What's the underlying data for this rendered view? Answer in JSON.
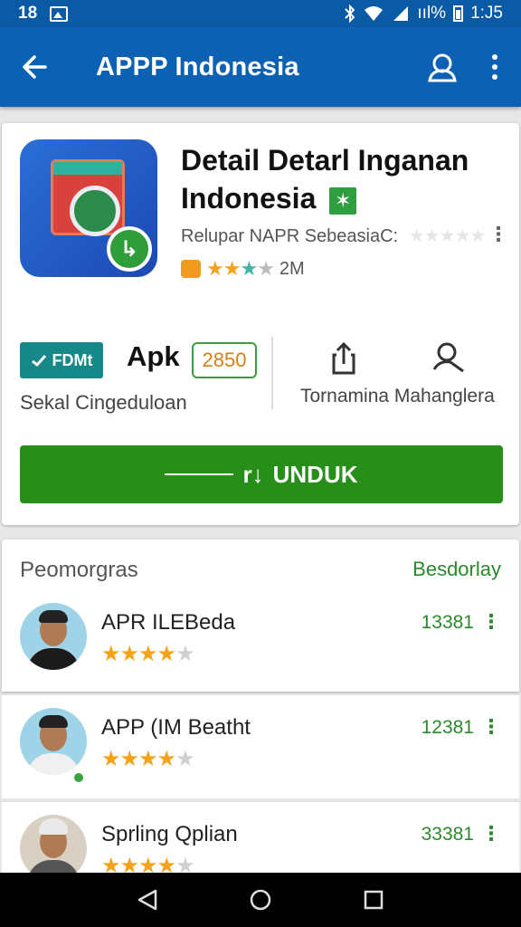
{
  "status_bar": {
    "left_time": "18",
    "right_time": "1:J5",
    "signal_pct": "ııl%"
  },
  "app_bar": {
    "title": "APPP Indonesia"
  },
  "app": {
    "title_line1": "Detail Detarl Inganan",
    "title_line2": "Indonesia",
    "verified_mark": "✶",
    "publisher": "Relupar NAPR SebeasiaC:",
    "publisher_stars": "★★★★★",
    "rating_stars_gold": "★★",
    "rating_stars_green": "★",
    "rating_stars_grey": "★",
    "rating_count": "2M",
    "more_glyph": "⋮"
  },
  "info": {
    "badge_label": "FDMt",
    "type_label": "Apk",
    "count_badge": "2850",
    "size_label": "Sekal Cingeduloan",
    "share_label": "Tornamina Mahanglera"
  },
  "download": {
    "label": "UNDUK",
    "glyph": "r↓"
  },
  "comments": {
    "title": "Peomorgras",
    "link": "Besdorlay",
    "items": [
      {
        "name": "APR ILEBeda",
        "stars_on": "★★★★",
        "stars_off": "★",
        "count": "13381",
        "more": "⋮"
      },
      {
        "name": "APP (IM Beatht",
        "stars_on": "★★★★",
        "stars_off": "★",
        "count": "12381",
        "more": "⋮"
      },
      {
        "name": "Sprling Qplian",
        "stars_on": "★★★★",
        "stars_off": "★",
        "count": "33381",
        "more": "⋮"
      }
    ]
  },
  "colors": {
    "app_bar": "#0d61b3",
    "download": "#288e1a",
    "accent_green": "#2a8a2a",
    "star": "#f4a21a"
  },
  "icons": [
    "back-arrow-icon",
    "account-icon",
    "overflow-menu-icon",
    "share-icon",
    "person-icon",
    "back-nav-icon",
    "home-nav-icon",
    "recents-nav-icon"
  ]
}
